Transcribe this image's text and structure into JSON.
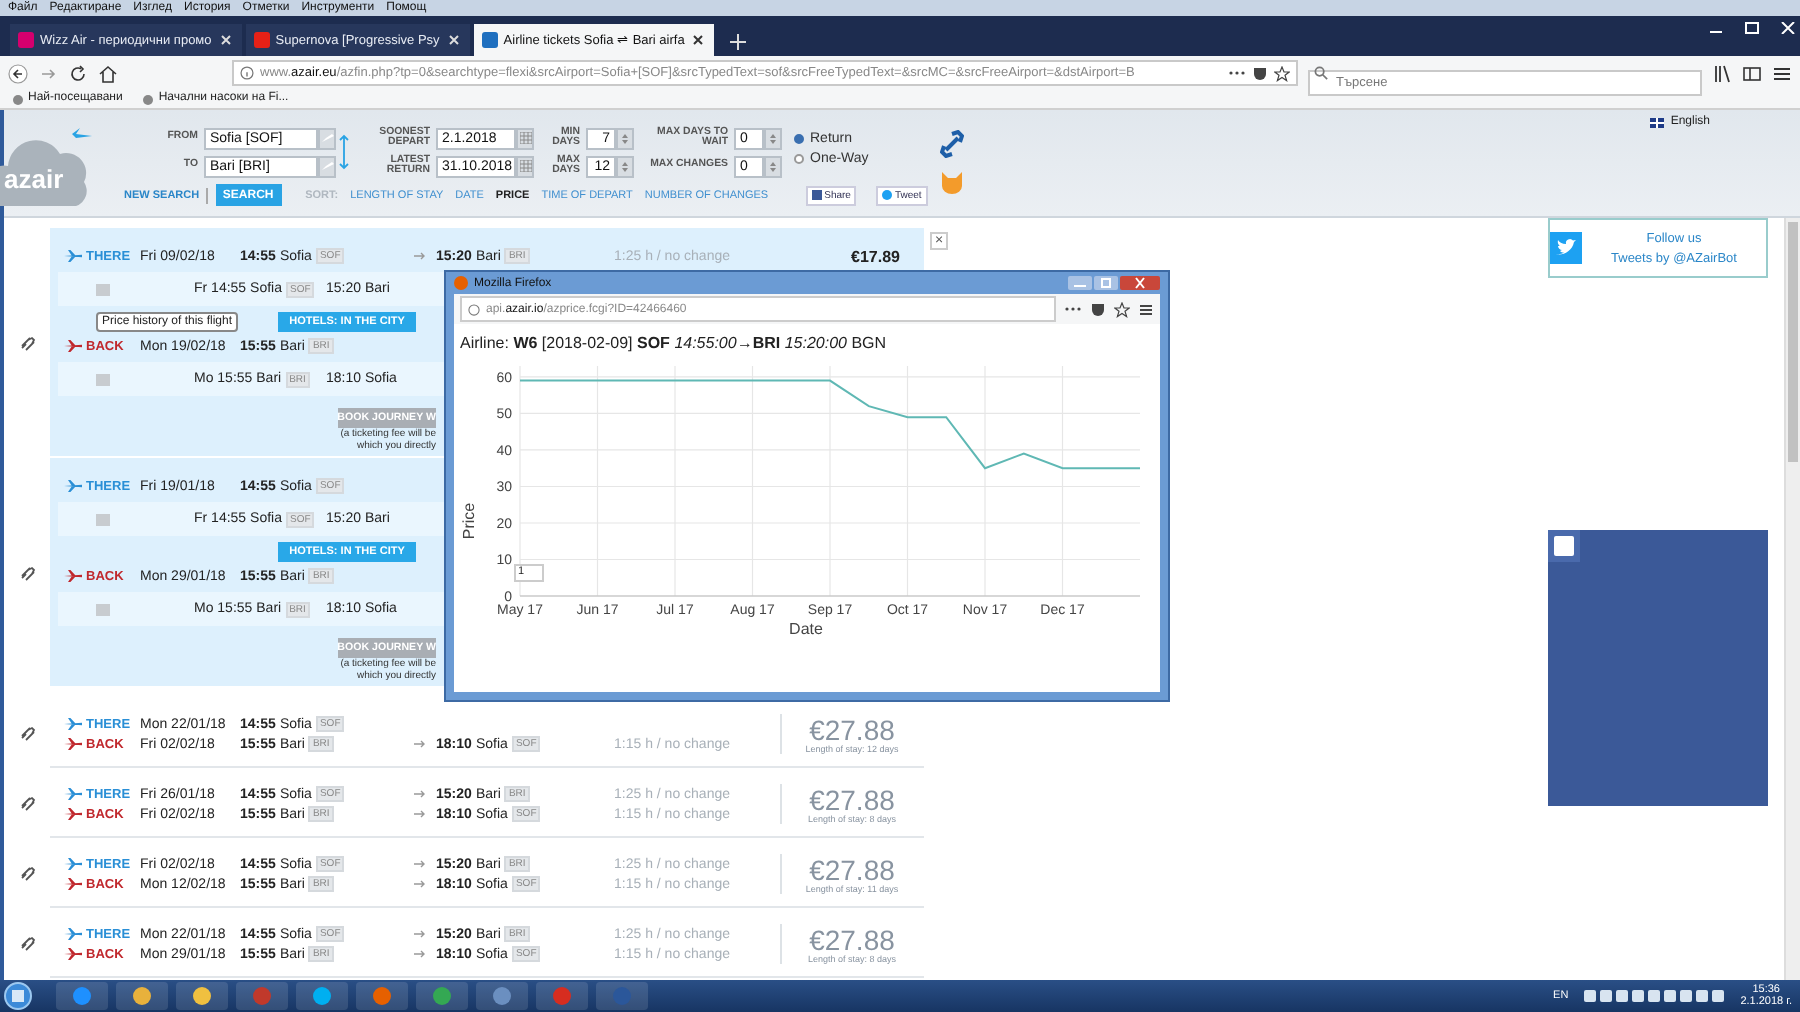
{
  "browser": {
    "menu": [
      "Файл",
      "Редактиране",
      "Изглед",
      "История",
      "Отметки",
      "Инструменти",
      "Помощ"
    ],
    "tabs": [
      {
        "label": "Wizz Air - периодични промо",
        "selected": false
      },
      {
        "label": "Supernova [Progressive Psy",
        "selected": false
      },
      {
        "label": "Airline tickets Sofia ⇌ Bari airfa",
        "selected": true
      }
    ],
    "url": "www.**azair.eu**/azfin.php?tp=0&searchtype=flexi&srcAirport=Sofia+[SOF]&srcTypedText=sof&srcFreeTypedText=&srcMC=&srcFreeAirport=&dstAirport=B",
    "search": {
      "placeholder": "Търсене"
    },
    "bookmarks": [
      "Най-посещавани",
      "Начални насоки на Fi..."
    ]
  },
  "header": {
    "logo": "azair",
    "from": {
      "label": "FROM",
      "value": "Sofia [SOF]"
    },
    "to": {
      "label": "TO",
      "value": "Bari [BRI]"
    },
    "soonest": {
      "label": "SOONEST DEPART",
      "value": "2.1.2018"
    },
    "latest": {
      "label": "LATEST RETURN",
      "value": "31.10.2018"
    },
    "min_days": {
      "label": "MIN DAYS",
      "value": "7"
    },
    "max_days": {
      "label": "MAX DAYS",
      "value": "12"
    },
    "max_wait": {
      "label": "MAX DAYS TO WAIT",
      "value": "0"
    },
    "max_changes": {
      "label": "MAX CHANGES",
      "value": "0"
    },
    "trip_types": [
      {
        "label": "Return",
        "selected": true
      },
      {
        "label": "One-Way",
        "selected": false
      }
    ],
    "new_search": "NEW SEARCH",
    "search_button": "SEARCH",
    "sort_label": "SORT:",
    "sort_options": [
      {
        "label": "LENGTH OF STAY",
        "selected": false
      },
      {
        "label": "DATE",
        "selected": false
      },
      {
        "label": "PRICE",
        "selected": true
      },
      {
        "label": "TIME OF DEPART",
        "selected": false
      },
      {
        "label": "NUMBER OF CHANGES",
        "selected": false
      }
    ],
    "share": "Share",
    "tweet": "Tweet",
    "language": "English"
  },
  "expanded": [
    {
      "close": "×",
      "tooltip": "Price history of this flight",
      "there": {
        "label": "THERE",
        "date": "Fri 09/02/18",
        "time": "14:55",
        "city": "Sofia",
        "code": "SOF",
        "arr_time": "15:20",
        "arr_city": "Bari",
        "arr_code": "BRI",
        "duration": "1:25 h / no change",
        "price": "€17.89"
      },
      "there_detail": {
        "day_time": "Fr 14:55",
        "city": "Sofia",
        "code": "SOF",
        "arrival": "15:20 Bari"
      },
      "hotels": "HOTELS: IN THE CITY",
      "back": {
        "label": "BACK",
        "date": "Mon 19/02/18",
        "time": "15:55",
        "city": "Bari",
        "code": "BRI"
      },
      "back_detail": {
        "day_time": "Mo 15:55",
        "city": "Bari",
        "code": "BRI",
        "arrival": "18:10 Sofia"
      },
      "book": "BOOK JOURNEY W",
      "fee_note": [
        "(a ticketing fee will be",
        "which you directly"
      ]
    },
    {
      "there": {
        "label": "THERE",
        "date": "Fri 19/01/18",
        "time": "14:55",
        "city": "Sofia",
        "code": "SOF"
      },
      "there_detail": {
        "day_time": "Fr 14:55",
        "city": "Sofia",
        "code": "SOF",
        "arrival": "15:20 Bari"
      },
      "hotels": "HOTELS: IN THE CITY",
      "back": {
        "label": "BACK",
        "date": "Mon 29/01/18",
        "time": "15:55",
        "city": "Bari",
        "code": "BRI"
      },
      "back_detail": {
        "day_time": "Mo 15:55",
        "city": "Bari",
        "code": "BRI",
        "arrival": "18:10 Sofia"
      },
      "book": "BOOK JOURNEY W",
      "fee_note": [
        "(a ticketing fee will be",
        "which you directly"
      ]
    }
  ],
  "results": [
    {
      "there": {
        "label": "THERE",
        "date": "Mon 22/01/18",
        "time": "14:55",
        "city": "Sofia",
        "code": "SOF"
      },
      "back": {
        "label": "BACK",
        "date": "Fri 02/02/18",
        "time": "15:55",
        "city": "Bari",
        "code": "BRI",
        "arr_time": "18:10",
        "arr_city": "Sofia",
        "arr_code": "SOF",
        "duration": "1:15 h / no change"
      },
      "price": "€27.88",
      "stay": "Length of stay: 12 days"
    },
    {
      "there": {
        "label": "THERE",
        "date": "Fri 26/01/18",
        "time": "14:55",
        "city": "Sofia",
        "code": "SOF",
        "arr_time": "15:20",
        "arr_city": "Bari",
        "arr_code": "BRI",
        "duration": "1:25 h / no change"
      },
      "back": {
        "label": "BACK",
        "date": "Fri 02/02/18",
        "time": "15:55",
        "city": "Bari",
        "code": "BRI",
        "arr_time": "18:10",
        "arr_city": "Sofia",
        "arr_code": "SOF",
        "duration": "1:15 h / no change"
      },
      "price": "€27.88",
      "stay": "Length of stay: 8 days"
    },
    {
      "there": {
        "label": "THERE",
        "date": "Fri 02/02/18",
        "time": "14:55",
        "city": "Sofia",
        "code": "SOF",
        "arr_time": "15:20",
        "arr_city": "Bari",
        "arr_code": "BRI",
        "duration": "1:25 h / no change"
      },
      "back": {
        "label": "BACK",
        "date": "Mon 12/02/18",
        "time": "15:55",
        "city": "Bari",
        "code": "BRI",
        "arr_time": "18:10",
        "arr_city": "Sofia",
        "arr_code": "SOF",
        "duration": "1:15 h / no change"
      },
      "price": "€27.88",
      "stay": "Length of stay: 11 days"
    },
    {
      "there": {
        "label": "THERE",
        "date": "Mon 22/01/18",
        "time": "14:55",
        "city": "Sofia",
        "code": "SOF",
        "arr_time": "15:20",
        "arr_city": "Bari",
        "arr_code": "BRI",
        "duration": "1:25 h / no change"
      },
      "back": {
        "label": "BACK",
        "date": "Mon 29/01/18",
        "time": "15:55",
        "city": "Bari",
        "code": "BRI",
        "arr_time": "18:10",
        "arr_city": "Sofia",
        "arr_code": "SOF",
        "duration": "1:15 h / no change"
      },
      "price": "€27.88",
      "stay": "Length of stay: 8 days"
    }
  ],
  "twitter": {
    "title": "Follow us",
    "handle": "Tweets by @AZairBot"
  },
  "popup": {
    "title": "Mozilla Firefox",
    "url": "api.**azair.io**/azprice.fcgi?ID=42466460",
    "heading": "Airline: **W6** [2018-02-09] **SOF** *14:55:00*→**BRI** *15:20:00* BGN",
    "range_value": "1",
    "chart_data": {
      "type": "line",
      "xlabel": "Date",
      "ylabel": "Price",
      "categories": [
        "May 17",
        null,
        "Jun 17",
        null,
        "Jul 17",
        null,
        "Aug 17",
        null,
        "Sep 17",
        null,
        "Oct 17",
        null,
        "Nov 17",
        null,
        "Dec 17",
        null,
        null
      ],
      "grid": true,
      "series": [
        {
          "color": "#5fb8b4",
          "values": [
            59,
            59,
            59,
            59,
            59,
            59,
            59,
            59,
            59,
            52,
            49,
            49,
            35,
            39,
            35,
            35,
            35
          ]
        }
      ],
      "ylim": [
        0,
        63
      ],
      "yticks": [
        0,
        10,
        20,
        30,
        40,
        50,
        60
      ]
    }
  },
  "taskbar": {
    "language": "EN",
    "time": "15:36",
    "date": "2.1.2018 г."
  }
}
